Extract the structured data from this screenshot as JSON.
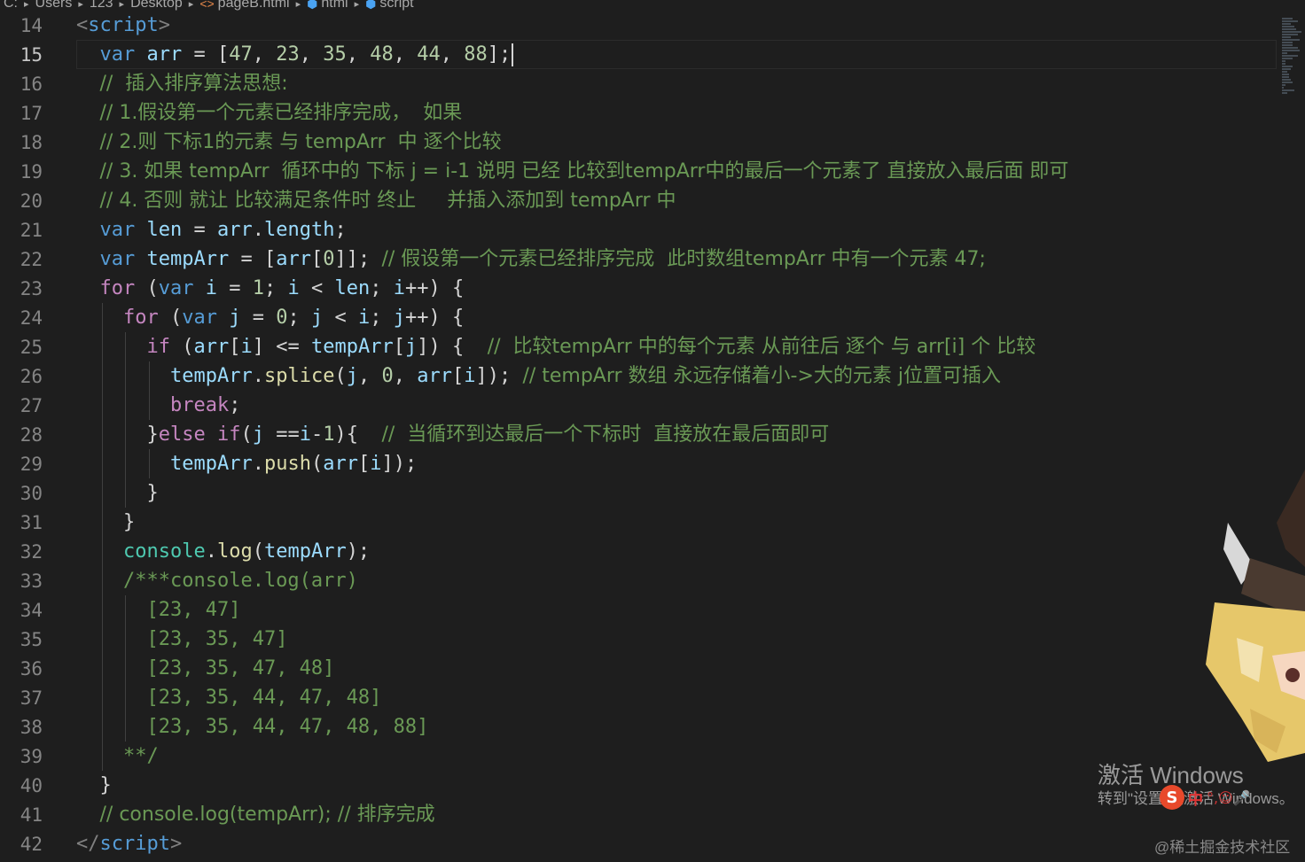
{
  "breadcrumb": {
    "items": [
      "C:",
      "Users",
      "123",
      "Desktop",
      "pageB.html",
      "html",
      "script"
    ]
  },
  "editor": {
    "cursor_line": "15",
    "lines": [
      {
        "n": "14",
        "indent": 0,
        "tokens": [
          [
            "tagp",
            "<"
          ],
          [
            "tag",
            "script"
          ],
          [
            "tagp",
            ">"
          ]
        ]
      },
      {
        "n": "15",
        "indent": 1,
        "tokens": [
          [
            "kw",
            "var"
          ],
          [
            "pl",
            " "
          ],
          [
            "var",
            "arr"
          ],
          [
            "pl",
            " = ["
          ],
          [
            "num",
            "47"
          ],
          [
            "pl",
            ", "
          ],
          [
            "num",
            "23"
          ],
          [
            "pl",
            ", "
          ],
          [
            "num",
            "35"
          ],
          [
            "pl",
            ", "
          ],
          [
            "num",
            "48"
          ],
          [
            "pl",
            ", "
          ],
          [
            "num",
            "44"
          ],
          [
            "pl",
            ", "
          ],
          [
            "num",
            "88"
          ],
          [
            "pl",
            "];"
          ]
        ]
      },
      {
        "n": "16",
        "indent": 1,
        "tokens": [
          [
            "cm",
            "//  插入排序算法思想:"
          ]
        ]
      },
      {
        "n": "17",
        "indent": 1,
        "tokens": [
          [
            "cm",
            "// 1.假设第一个元素已经排序完成，  如果"
          ]
        ]
      },
      {
        "n": "18",
        "indent": 1,
        "tokens": [
          [
            "cm",
            "// 2.则 下标1的元素 与 tempArr  中 逐个比较"
          ]
        ]
      },
      {
        "n": "19",
        "indent": 1,
        "tokens": [
          [
            "cm",
            "// 3. 如果 tempArr  循环中的 下标 j = i-1 说明 已经 比较到tempArr中的最后一个元素了 直接放入最后面 即可"
          ]
        ]
      },
      {
        "n": "20",
        "indent": 1,
        "tokens": [
          [
            "cm",
            "// 4. 否则 就让 比较满足条件时 终止     并插入添加到 tempArr 中"
          ]
        ]
      },
      {
        "n": "21",
        "indent": 1,
        "tokens": [
          [
            "kw",
            "var"
          ],
          [
            "pl",
            " "
          ],
          [
            "var",
            "len"
          ],
          [
            "pl",
            " = "
          ],
          [
            "var",
            "arr"
          ],
          [
            "pl",
            "."
          ],
          [
            "var",
            "length"
          ],
          [
            "pl",
            ";"
          ]
        ]
      },
      {
        "n": "22",
        "indent": 1,
        "tokens": [
          [
            "kw",
            "var"
          ],
          [
            "pl",
            " "
          ],
          [
            "var",
            "tempArr"
          ],
          [
            "pl",
            " = ["
          ],
          [
            "var",
            "arr"
          ],
          [
            "pl",
            "["
          ],
          [
            "num",
            "0"
          ],
          [
            "pl",
            "]]; "
          ],
          [
            "cm",
            "// 假设第一个元素已经排序完成  此时数组tempArr 中有一个元素 47;"
          ]
        ]
      },
      {
        "n": "23",
        "indent": 1,
        "tokens": [
          [
            "ctl",
            "for"
          ],
          [
            "pl",
            " ("
          ],
          [
            "kw",
            "var"
          ],
          [
            "pl",
            " "
          ],
          [
            "var",
            "i"
          ],
          [
            "pl",
            " = "
          ],
          [
            "num",
            "1"
          ],
          [
            "pl",
            "; "
          ],
          [
            "var",
            "i"
          ],
          [
            "pl",
            " < "
          ],
          [
            "var",
            "len"
          ],
          [
            "pl",
            "; "
          ],
          [
            "var",
            "i"
          ],
          [
            "pl",
            "++) {"
          ]
        ]
      },
      {
        "n": "24",
        "indent": 2,
        "tokens": [
          [
            "ctl",
            "for"
          ],
          [
            "pl",
            " ("
          ],
          [
            "kw",
            "var"
          ],
          [
            "pl",
            " "
          ],
          [
            "var",
            "j"
          ],
          [
            "pl",
            " = "
          ],
          [
            "num",
            "0"
          ],
          [
            "pl",
            "; "
          ],
          [
            "var",
            "j"
          ],
          [
            "pl",
            " < "
          ],
          [
            "var",
            "i"
          ],
          [
            "pl",
            "; "
          ],
          [
            "var",
            "j"
          ],
          [
            "pl",
            "++) {"
          ]
        ]
      },
      {
        "n": "25",
        "indent": 3,
        "tokens": [
          [
            "ctl",
            "if"
          ],
          [
            "pl",
            " ("
          ],
          [
            "var",
            "arr"
          ],
          [
            "pl",
            "["
          ],
          [
            "var",
            "i"
          ],
          [
            "pl",
            "] <= "
          ],
          [
            "var",
            "tempArr"
          ],
          [
            "pl",
            "["
          ],
          [
            "var",
            "j"
          ],
          [
            "pl",
            "]) {  "
          ],
          [
            "cm",
            "//  比较tempArr 中的每个元素 从前往后 逐个 与 arr[i] 个 比较"
          ]
        ]
      },
      {
        "n": "26",
        "indent": 4,
        "tokens": [
          [
            "var",
            "tempArr"
          ],
          [
            "pl",
            "."
          ],
          [
            "fn",
            "splice"
          ],
          [
            "pl",
            "("
          ],
          [
            "var",
            "j"
          ],
          [
            "pl",
            ", "
          ],
          [
            "num",
            "0"
          ],
          [
            "pl",
            ", "
          ],
          [
            "var",
            "arr"
          ],
          [
            "pl",
            "["
          ],
          [
            "var",
            "i"
          ],
          [
            "pl",
            "]); "
          ],
          [
            "cm",
            "// tempArr 数组 永远存储着小->大的元素 j位置可插入"
          ]
        ]
      },
      {
        "n": "27",
        "indent": 4,
        "tokens": [
          [
            "ctl",
            "break"
          ],
          [
            "pl",
            ";"
          ]
        ]
      },
      {
        "n": "28",
        "indent": 3,
        "tokens": [
          [
            "pl",
            "}"
          ],
          [
            "ctl",
            "else"
          ],
          [
            "pl",
            " "
          ],
          [
            "ctl",
            "if"
          ],
          [
            "pl",
            "("
          ],
          [
            "var",
            "j"
          ],
          [
            "pl",
            " =="
          ],
          [
            "var",
            "i"
          ],
          [
            "pl",
            "-"
          ],
          [
            "num",
            "1"
          ],
          [
            "pl",
            "){  "
          ],
          [
            "cm",
            "//  当循环到达最后一个下标时  直接放在最后面即可"
          ]
        ]
      },
      {
        "n": "29",
        "indent": 4,
        "tokens": [
          [
            "var",
            "tempArr"
          ],
          [
            "pl",
            "."
          ],
          [
            "fn",
            "push"
          ],
          [
            "pl",
            "("
          ],
          [
            "var",
            "arr"
          ],
          [
            "pl",
            "["
          ],
          [
            "var",
            "i"
          ],
          [
            "pl",
            "]);"
          ]
        ]
      },
      {
        "n": "30",
        "indent": 3,
        "tokens": [
          [
            "pl",
            "}"
          ]
        ]
      },
      {
        "n": "31",
        "indent": 2,
        "tokens": [
          [
            "pl",
            "}"
          ]
        ]
      },
      {
        "n": "32",
        "indent": 2,
        "tokens": [
          [
            "obj",
            "console"
          ],
          [
            "pl",
            "."
          ],
          [
            "fn",
            "log"
          ],
          [
            "pl",
            "("
          ],
          [
            "var",
            "tempArr"
          ],
          [
            "pl",
            ");"
          ]
        ]
      },
      {
        "n": "33",
        "indent": 2,
        "tokens": [
          [
            "cm",
            "/***console.log(arr)"
          ]
        ]
      },
      {
        "n": "34",
        "indent": 3,
        "tokens": [
          [
            "cm",
            "[23, 47]"
          ]
        ]
      },
      {
        "n": "35",
        "indent": 3,
        "tokens": [
          [
            "cm",
            "[23, 35, 47]"
          ]
        ]
      },
      {
        "n": "36",
        "indent": 3,
        "tokens": [
          [
            "cm",
            "[23, 35, 47, 48]"
          ]
        ]
      },
      {
        "n": "37",
        "indent": 3,
        "tokens": [
          [
            "cm",
            "[23, 35, 44, 47, 48]"
          ]
        ]
      },
      {
        "n": "38",
        "indent": 3,
        "tokens": [
          [
            "cm",
            "[23, 35, 44, 47, 48, 88]"
          ]
        ]
      },
      {
        "n": "39",
        "indent": 2,
        "tokens": [
          [
            "cm",
            "**/"
          ]
        ]
      },
      {
        "n": "40",
        "indent": 1,
        "tokens": [
          [
            "pl",
            "}"
          ]
        ]
      },
      {
        "n": "41",
        "indent": 1,
        "tokens": [
          [
            "cm",
            "// console.log(tempArr); // 排序完成"
          ]
        ]
      },
      {
        "n": "42",
        "indent": 0,
        "tokens": [
          [
            "tagp",
            "</"
          ],
          [
            "tag",
            "script"
          ],
          [
            "tagp",
            ">"
          ]
        ]
      }
    ]
  },
  "overlay": {
    "activate_title": "激活 Windows",
    "activate_sub": "转到\"设置\"以激活 Windows。",
    "ime_logo": "S",
    "ime_mode": "中",
    "ime_symbols": "°,☺🎤",
    "watermark": "@稀土掘金技术社区"
  },
  "colors": {
    "background": "#1e1e1e",
    "keyword": "#569cd6",
    "control": "#c586c0",
    "variable": "#9cdcfe",
    "number": "#b5cea8",
    "comment": "#6a9955",
    "function": "#dcdcaa",
    "object": "#4ec9b0"
  }
}
